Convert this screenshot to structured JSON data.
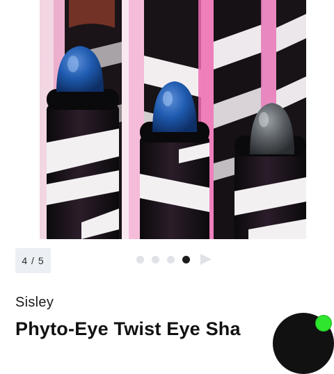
{
  "gallery": {
    "image_alt": "Sisley Phyto-Eye Twist pencils in blue and gray shades",
    "counter": "4 / 5",
    "total_images": 5,
    "active_index": 4
  },
  "product": {
    "brand": "Sisley",
    "title_visible": "Phyto-Eye Twist Eye Sha"
  },
  "chat": {
    "status": "online",
    "status_color": "#2ee62e"
  },
  "colors": {
    "pencil_blue": "#1d4f9c",
    "pencil_gray": "#5e6266",
    "background_pink": "#ee82c3"
  }
}
